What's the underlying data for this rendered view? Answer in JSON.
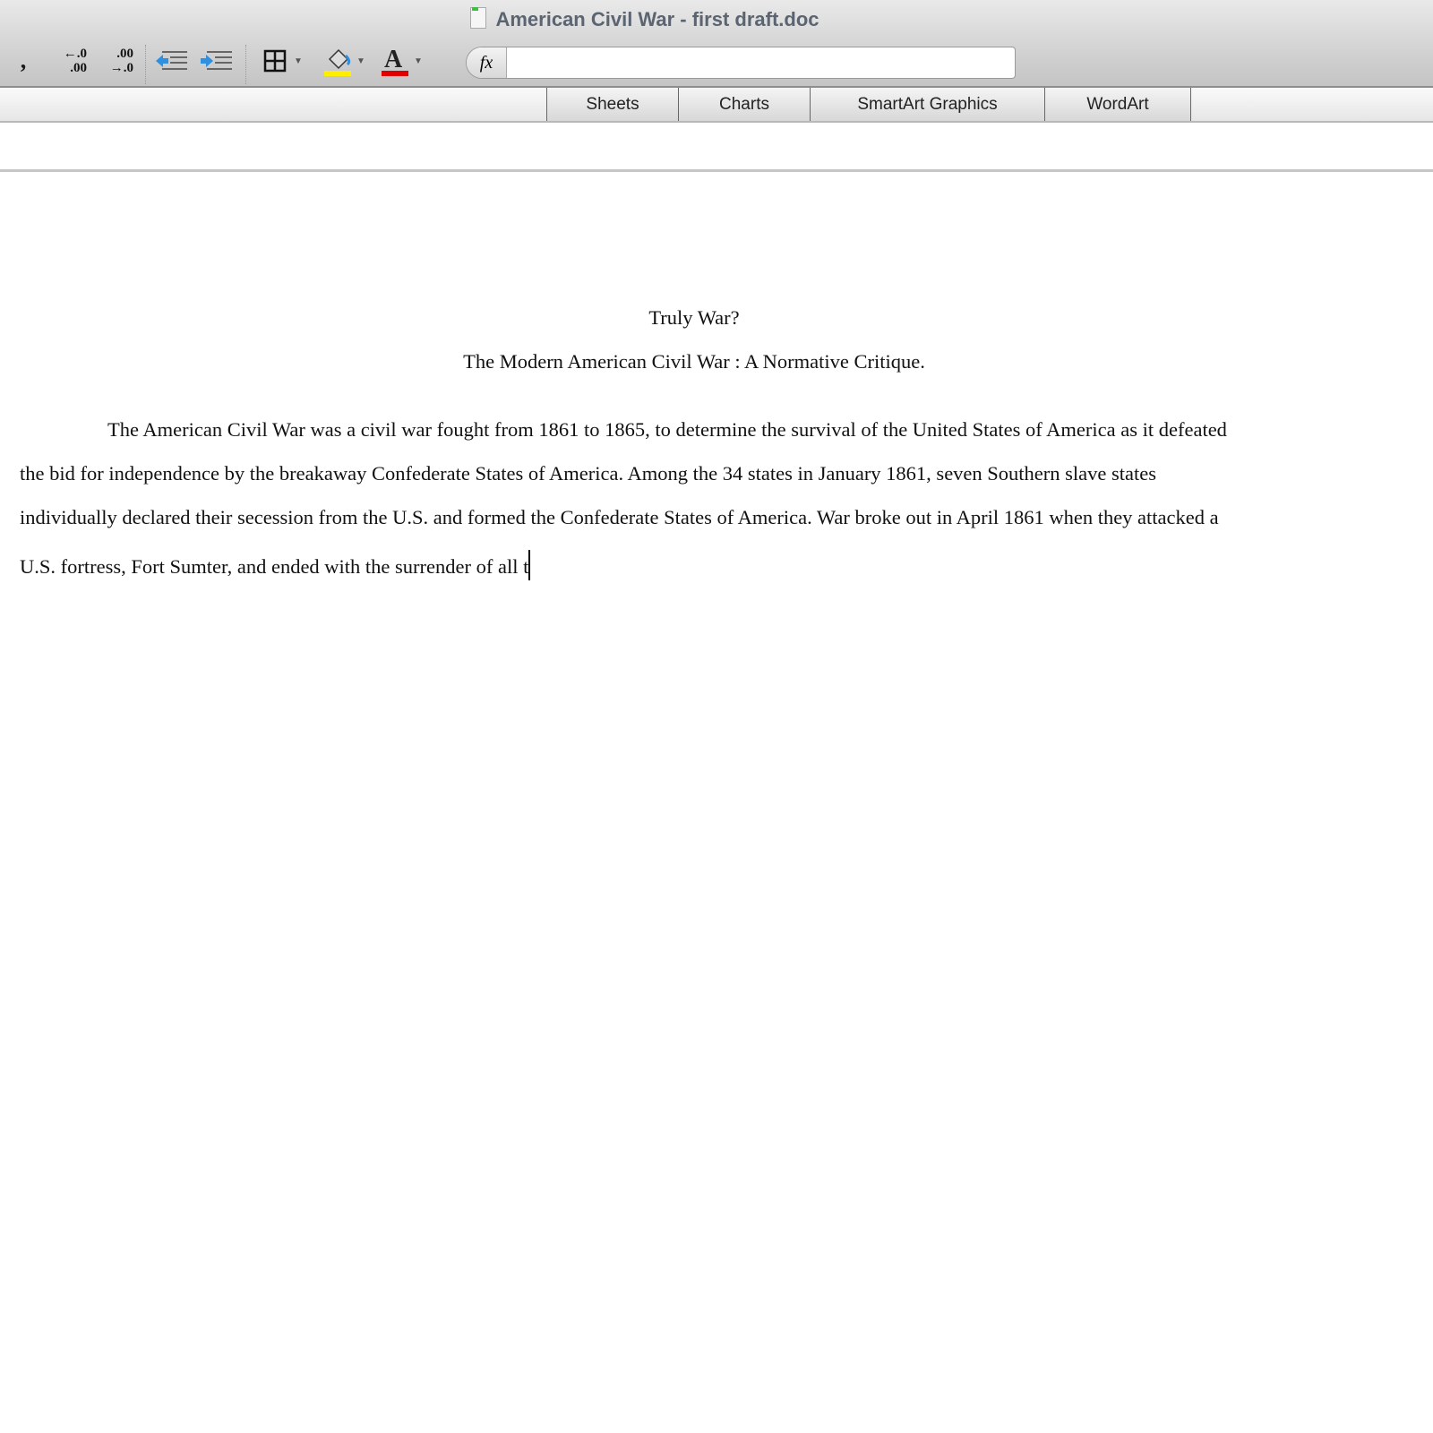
{
  "window": {
    "title": "American Civil War - first draft.doc",
    "icon": "document-icon"
  },
  "toolbar": {
    "comma_style": ",",
    "increase_decimal": "←.0 .00",
    "decrease_decimal": ".00 →.0",
    "formula_label": "fx",
    "formula_value": "",
    "fill_color": "#ffee00",
    "font_color": "#e00000"
  },
  "ribbon": {
    "tabs": [
      {
        "label": "Sheets"
      },
      {
        "label": "Charts"
      },
      {
        "label": "SmartArt Graphics"
      },
      {
        "label": "WordArt"
      }
    ]
  },
  "document": {
    "title": "Truly War?",
    "subtitle": "The Modern American Civil War : A Normative Critique.",
    "paragraph_lines": [
      "The American Civil War was a civil war fought from 1861 to 1865, to determine the survival of the United States of America as it defeated",
      "the bid for independence by the breakaway Confederate States of America. Among the 34 states in January 1861, seven Southern slave states",
      "individually declared their secession from the U.S. and formed the Confederate States of America. War broke out in April 1861 when they attacked a",
      "U.S. fortress, Fort Sumter, and ended with the surrender of all t"
    ]
  }
}
